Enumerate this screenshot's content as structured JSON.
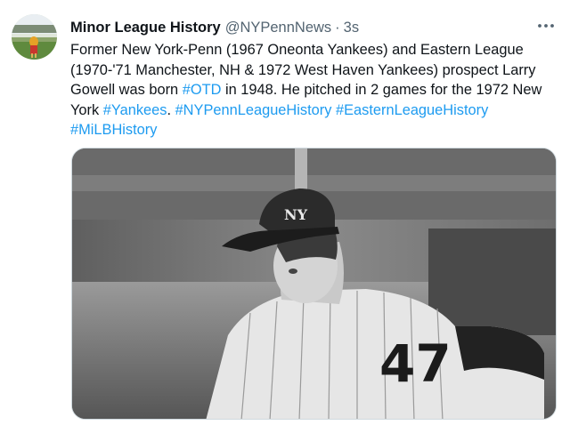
{
  "tweet": {
    "author_name": "Minor League History",
    "handle": "@NYPennNews",
    "separator": "·",
    "time": "3s",
    "text_segments": [
      {
        "text": "Former New York-Penn (1967 Oneonta Yankees) and Eastern League (1970-'71 Manchester, NH & 1972 West Haven Yankees) prospect Larry Gowell was born ",
        "link": false
      },
      {
        "text": "#OTD",
        "link": true
      },
      {
        "text": " in 1948. He pitched in 2 games for the 1972 New York ",
        "link": false
      },
      {
        "text": "#Yankees",
        "link": true
      },
      {
        "text": ". ",
        "link": false
      },
      {
        "text": "#NYPennLeagueHistory",
        "link": true
      },
      {
        "text": " ",
        "link": false
      },
      {
        "text": "#EasternLeagueHistory",
        "link": true
      },
      {
        "text": " ",
        "link": false
      },
      {
        "text": "#MiLBHistory",
        "link": true
      }
    ],
    "jersey_number": "47",
    "icons": {
      "avatar": "avatar-mascot-photo",
      "more": "more-options-icon",
      "photo": "pitcher-photo"
    },
    "colors": {
      "link": "#1d9bf0",
      "secondary_text": "#536471",
      "primary_text": "#0f1419"
    }
  }
}
